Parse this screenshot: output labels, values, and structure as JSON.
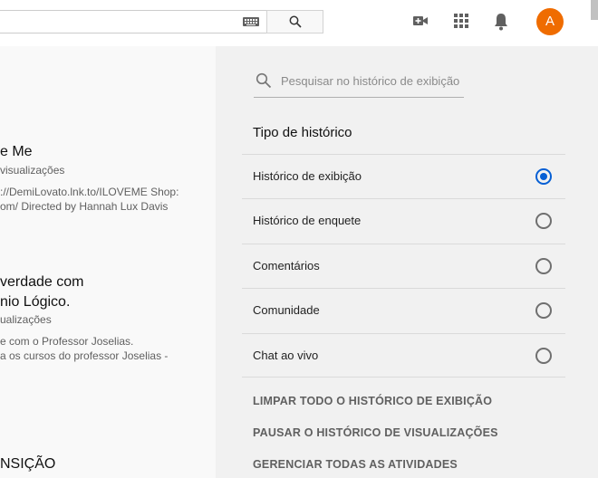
{
  "header": {
    "search_value": "",
    "avatar_letter": "A",
    "icons": [
      "keyboard-icon",
      "search-icon",
      "create-video-icon",
      "apps-icon",
      "notifications-icon"
    ]
  },
  "left_list": {
    "items": [
      {
        "title": "e Me",
        "meta": "visualizações",
        "desc1": "://DemiLovato.lnk.to/ILOVEME Shop:",
        "desc2": "om/ Directed by Hannah Lux Davis"
      },
      {
        "title1": " verdade com",
        "title2": "nio Lógico.",
        "meta": "ualizações",
        "desc1": "e com o Professor Joselias.",
        "desc2": "a os cursos do professor Joselias -"
      },
      {
        "title": "NSIÇÃO"
      }
    ]
  },
  "panel": {
    "search_placeholder": "Pesquisar no histórico de exibição",
    "section_title": "Tipo de histórico",
    "options": [
      {
        "label": "Histórico de exibição",
        "selected": true
      },
      {
        "label": "Histórico de enquete",
        "selected": false
      },
      {
        "label": "Comentários",
        "selected": false
      },
      {
        "label": "Comunidade",
        "selected": false
      },
      {
        "label": "Chat ao vivo",
        "selected": false
      }
    ],
    "actions": {
      "clear": "LIMPAR TODO O HISTÓRICO DE EXIBIÇÃO",
      "pause": "PAUSAR O HISTÓRICO DE VISUALIZAÇÕES",
      "manage": "GERENCIAR TODAS AS ATIVIDADES"
    }
  },
  "colors": {
    "accent": "#065fd4",
    "avatar": "#ef6c00"
  }
}
